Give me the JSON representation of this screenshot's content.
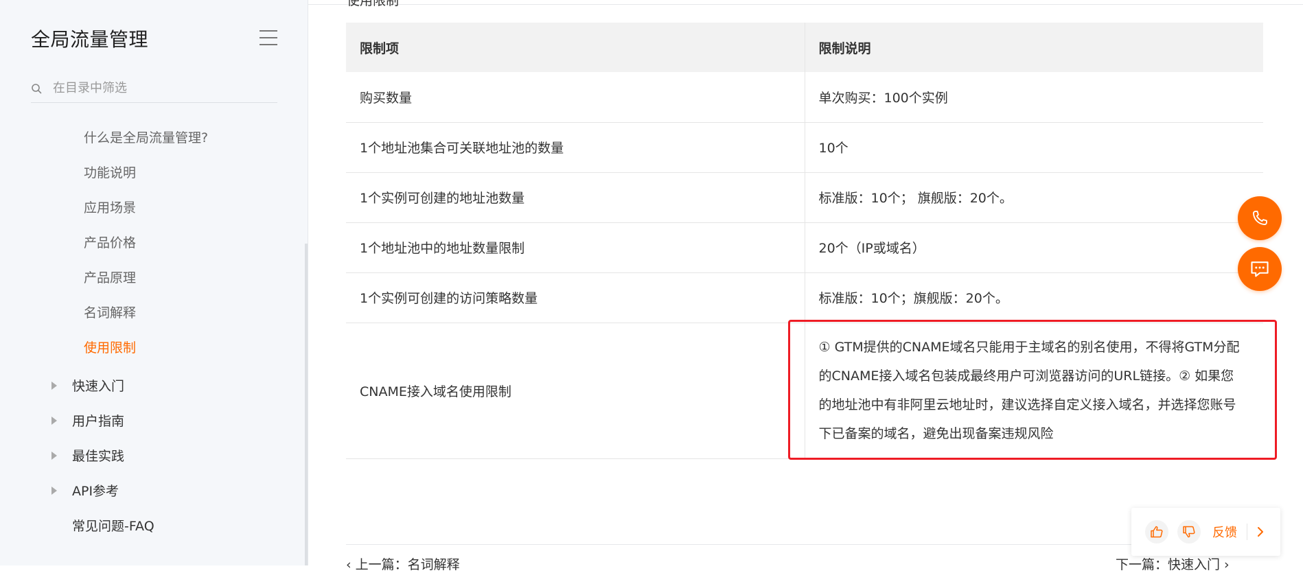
{
  "sidebar": {
    "title": "全局流量管理",
    "filter_placeholder": "在目录中筛选",
    "sub_items": [
      {
        "label": "什么是全局流量管理?"
      },
      {
        "label": "功能说明"
      },
      {
        "label": "应用场景"
      },
      {
        "label": "产品价格"
      },
      {
        "label": "产品原理"
      },
      {
        "label": "名词解释"
      },
      {
        "label": "使用限制",
        "active": true
      }
    ],
    "top_items": [
      {
        "label": "快速入门",
        "collapsible": true
      },
      {
        "label": "用户指南",
        "collapsible": true
      },
      {
        "label": "最佳实践",
        "collapsible": true
      },
      {
        "label": "API参考",
        "collapsible": true
      },
      {
        "label": "常见问题-FAQ",
        "collapsible": false
      }
    ]
  },
  "main": {
    "cut_heading": "使用限制",
    "table": {
      "headers": [
        "限制项",
        "限制说明"
      ],
      "rows": [
        [
          "购买数量",
          "单次购买：100个实例"
        ],
        [
          "1个地址池集合可关联地址池的数量",
          "10个"
        ],
        [
          "1个实例可创建的地址池数量",
          "标准版：10个； 旗舰版：20个。"
        ],
        [
          "1个地址池中的地址数量限制",
          "20个（IP或域名）"
        ],
        [
          "1个实例可创建的访问策略数量",
          "标准版：10个；旗舰版：20个。"
        ],
        [
          "CNAME接入域名使用限制",
          "① GTM提供的CNAME域名只能用于主域名的别名使用，不得将GTM分配的CNAME接入域名包装成最终用户可浏览器访问的URL链接。② 如果您的地址池中有非阿里云地址时，建议选择自定义接入域名，并选择您账号下已备案的域名，避免出现备案违规风险"
        ]
      ]
    },
    "prev_link": "上一篇：名词解释",
    "next_link": "下一篇：快速入门"
  },
  "feedback": {
    "label": "反馈"
  },
  "icons": {
    "phone": "phone-icon",
    "chat": "chat-icon",
    "thumbs_up": "thumbs-up-icon",
    "thumbs_down": "thumbs-down-icon",
    "menu": "menu-icon",
    "search": "search-icon"
  },
  "colors": {
    "accent": "#ff6a00",
    "highlight_box": "#ee1c25",
    "sidebar_bg": "#f5f7fa",
    "table_header_bg": "#f2f2f2"
  }
}
